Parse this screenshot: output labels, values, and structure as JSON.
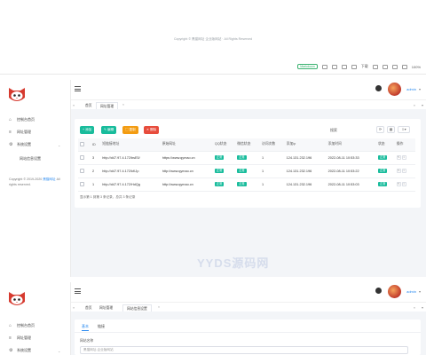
{
  "top": {
    "copyright": "Copyright © 黑猫网址 企业版网站 · All Rights Reserved",
    "toolbar_badge": "Markdown",
    "toolbar_download": "下载",
    "zoom": "100%"
  },
  "sidebar": {
    "items": [
      {
        "label": "控制台首页",
        "icon": "home-icon"
      },
      {
        "label": "网址管理",
        "icon": "list-icon"
      },
      {
        "label": "系统设置",
        "icon": "gear-icon"
      }
    ],
    "sub_items": [
      {
        "label": "网站信息设置"
      }
    ],
    "copyright_prefix": "Copyright © 2019-2020 ",
    "copyright_link": "黑猫网址",
    "copyright_suffix": " All rights reserved."
  },
  "header": {
    "user": "admin"
  },
  "tabs_list": [
    {
      "label": "首页"
    },
    {
      "label": "网址管理"
    }
  ],
  "toolbar": {
    "add": "+ 添加",
    "edit": "✎ 编辑",
    "copy": "▢ 复制",
    "delete": "✕ 删除",
    "search_label": "搜索"
  },
  "table": {
    "columns": [
      "ID",
      "短链接地址",
      "原始网址",
      "QQ状态",
      "微信状态",
      "访问次数",
      "添加ip",
      "添加时间",
      "状态",
      "操作"
    ],
    "rows": [
      {
        "id": "3",
        "short": "http://d47.97.4.172/bsE5/",
        "url": "https://www.qymao.cn",
        "qq": "正常",
        "wx": "正常",
        "visits": "1",
        "ip": "124.131.232.196",
        "time": "2022-08-11 10:53:33",
        "status": "正常"
      },
      {
        "id": "2",
        "short": "http://d47.97.4.172/kKJp",
        "url": "http://www.qymao.cn",
        "qq": "正常",
        "wx": "正常",
        "visits": "1",
        "ip": "124.131.232.196",
        "time": "2022-08-11 10:53:22",
        "status": "正常"
      },
      {
        "id": "1",
        "short": "http://d47.97.4.172/HdQg",
        "url": "http://www.qymao.cn",
        "qq": "正常",
        "wx": "正常",
        "visits": "1",
        "ip": "124.131.232.196",
        "time": "2022-08-11 10:53:03",
        "status": "正常"
      }
    ],
    "summary": "显示第 1 到第 3 条记录，总共 3 条记录"
  },
  "watermark": "YYDS源码网",
  "bottom": {
    "tabs": [
      {
        "label": "首页"
      },
      {
        "label": "网址管理"
      },
      {
        "label": "网站信息设置"
      }
    ],
    "form_tabs": [
      "基本",
      "链接"
    ],
    "field_label": "网站名称",
    "field_value": "黑猫网址-企业版网站"
  },
  "colors": {
    "accent": "#2d8cf0",
    "success": "#18bc9c",
    "warning": "#f39c12",
    "danger": "#e74c3c"
  }
}
